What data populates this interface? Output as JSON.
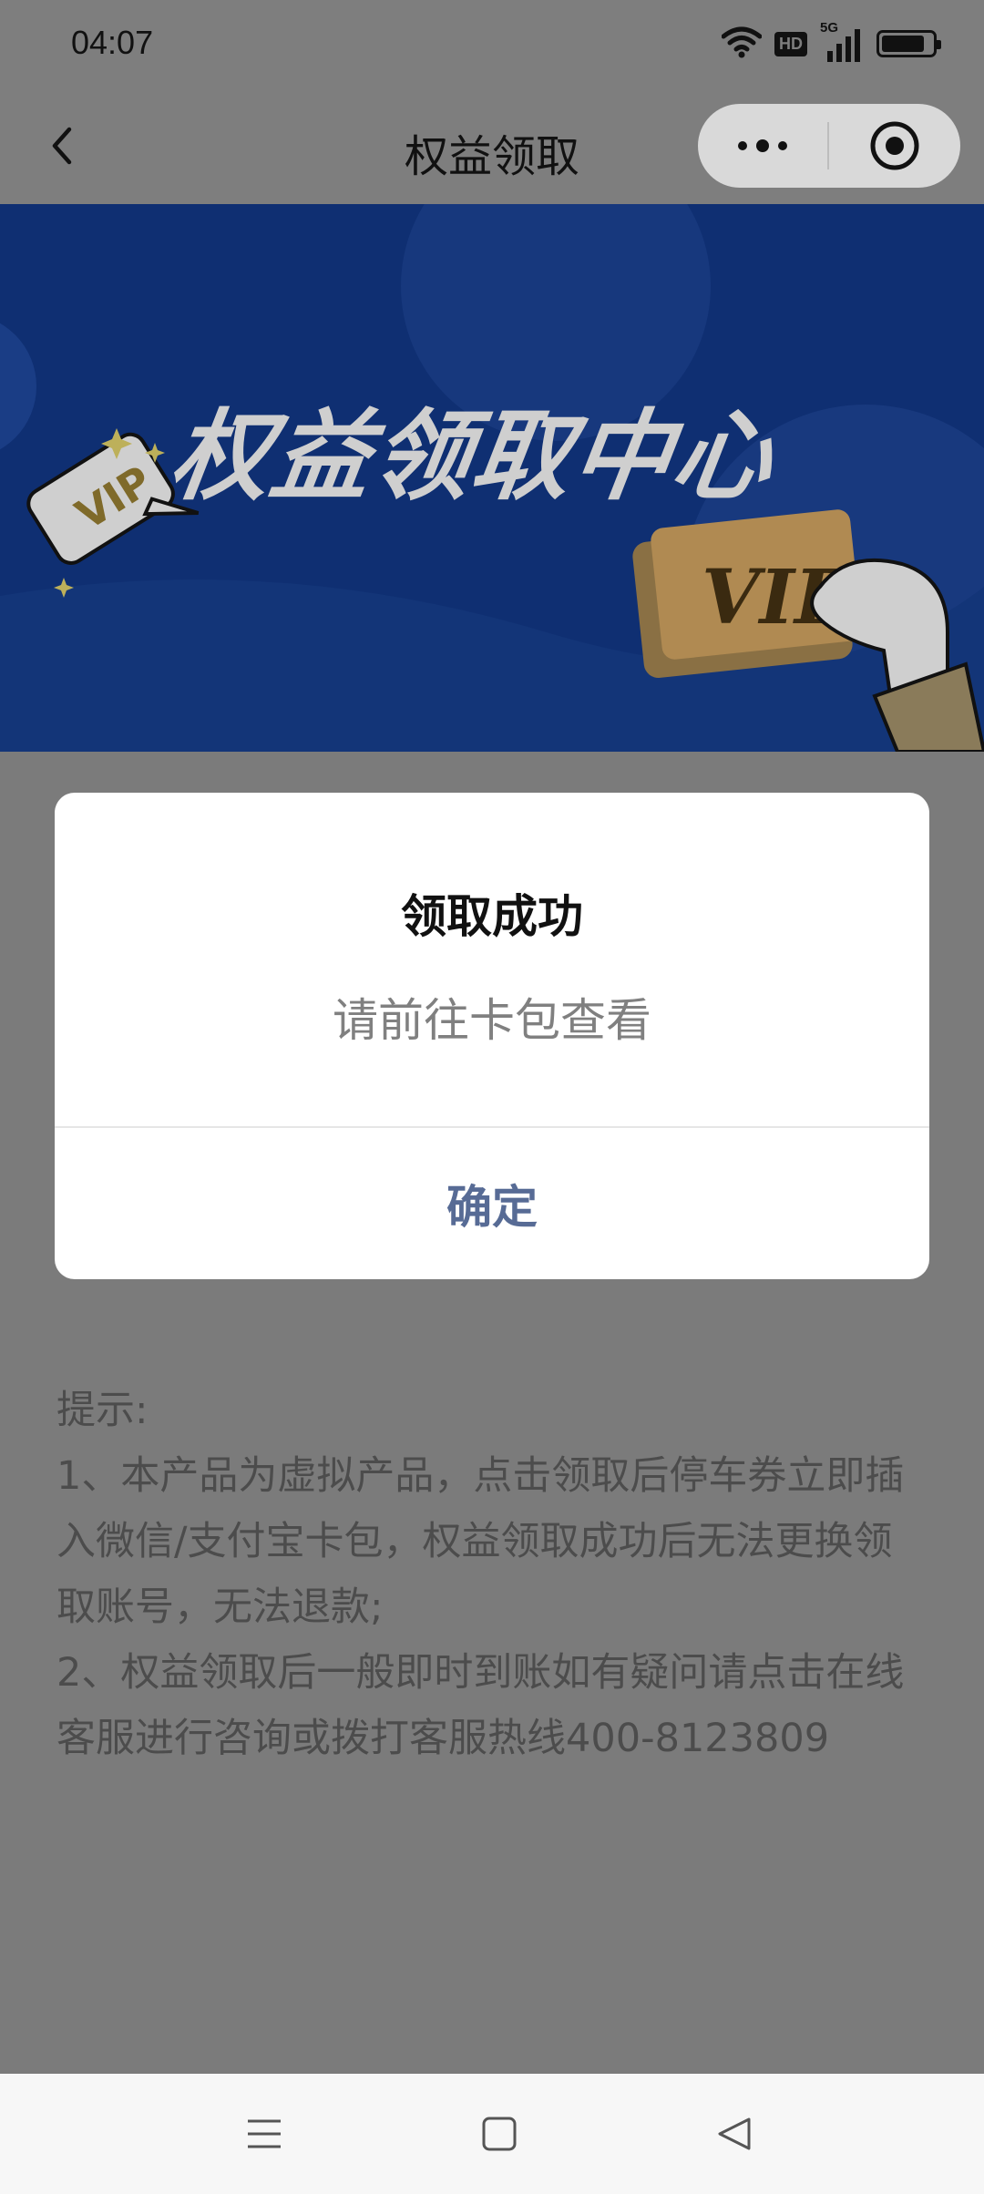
{
  "status_bar": {
    "time": "04:07",
    "icons": [
      "wifi-icon",
      "hd-icon",
      "signal-5g-icon",
      "battery-icon"
    ],
    "hd_label": "HD",
    "net_label": "5G",
    "battery_level": 0.85
  },
  "nav": {
    "title": "权益领取",
    "back_icon": "chevron-left-icon",
    "more_icon": "more-dots-icon",
    "close_icon": "target-circle-icon"
  },
  "banner": {
    "title": "权益领取中心",
    "badge_text": "VIP",
    "card_text": "VIP"
  },
  "tips": {
    "heading": "提示:",
    "line1": "1、本产品为虚拟产品，点击领取后停车券立即插入微信/支付宝卡包，权益领取成功后无法更换领取账号，无法退款;",
    "line2": "2、权益领取后一般即时到账如有疑问请点击在线客服进行咨询或拨打客服热线400-8123809"
  },
  "modal": {
    "title": "领取成功",
    "content": "请前往卡包查看",
    "confirm_label": "确定",
    "confirm_color": "#576b95"
  },
  "system_nav": {
    "icons": [
      "menu-icon",
      "home-square-icon",
      "back-triangle-icon"
    ]
  },
  "colors": {
    "mask_bg": "#7b7b7b",
    "banner_bg": "#0f2f72",
    "modal_bg": "#ffffff"
  }
}
